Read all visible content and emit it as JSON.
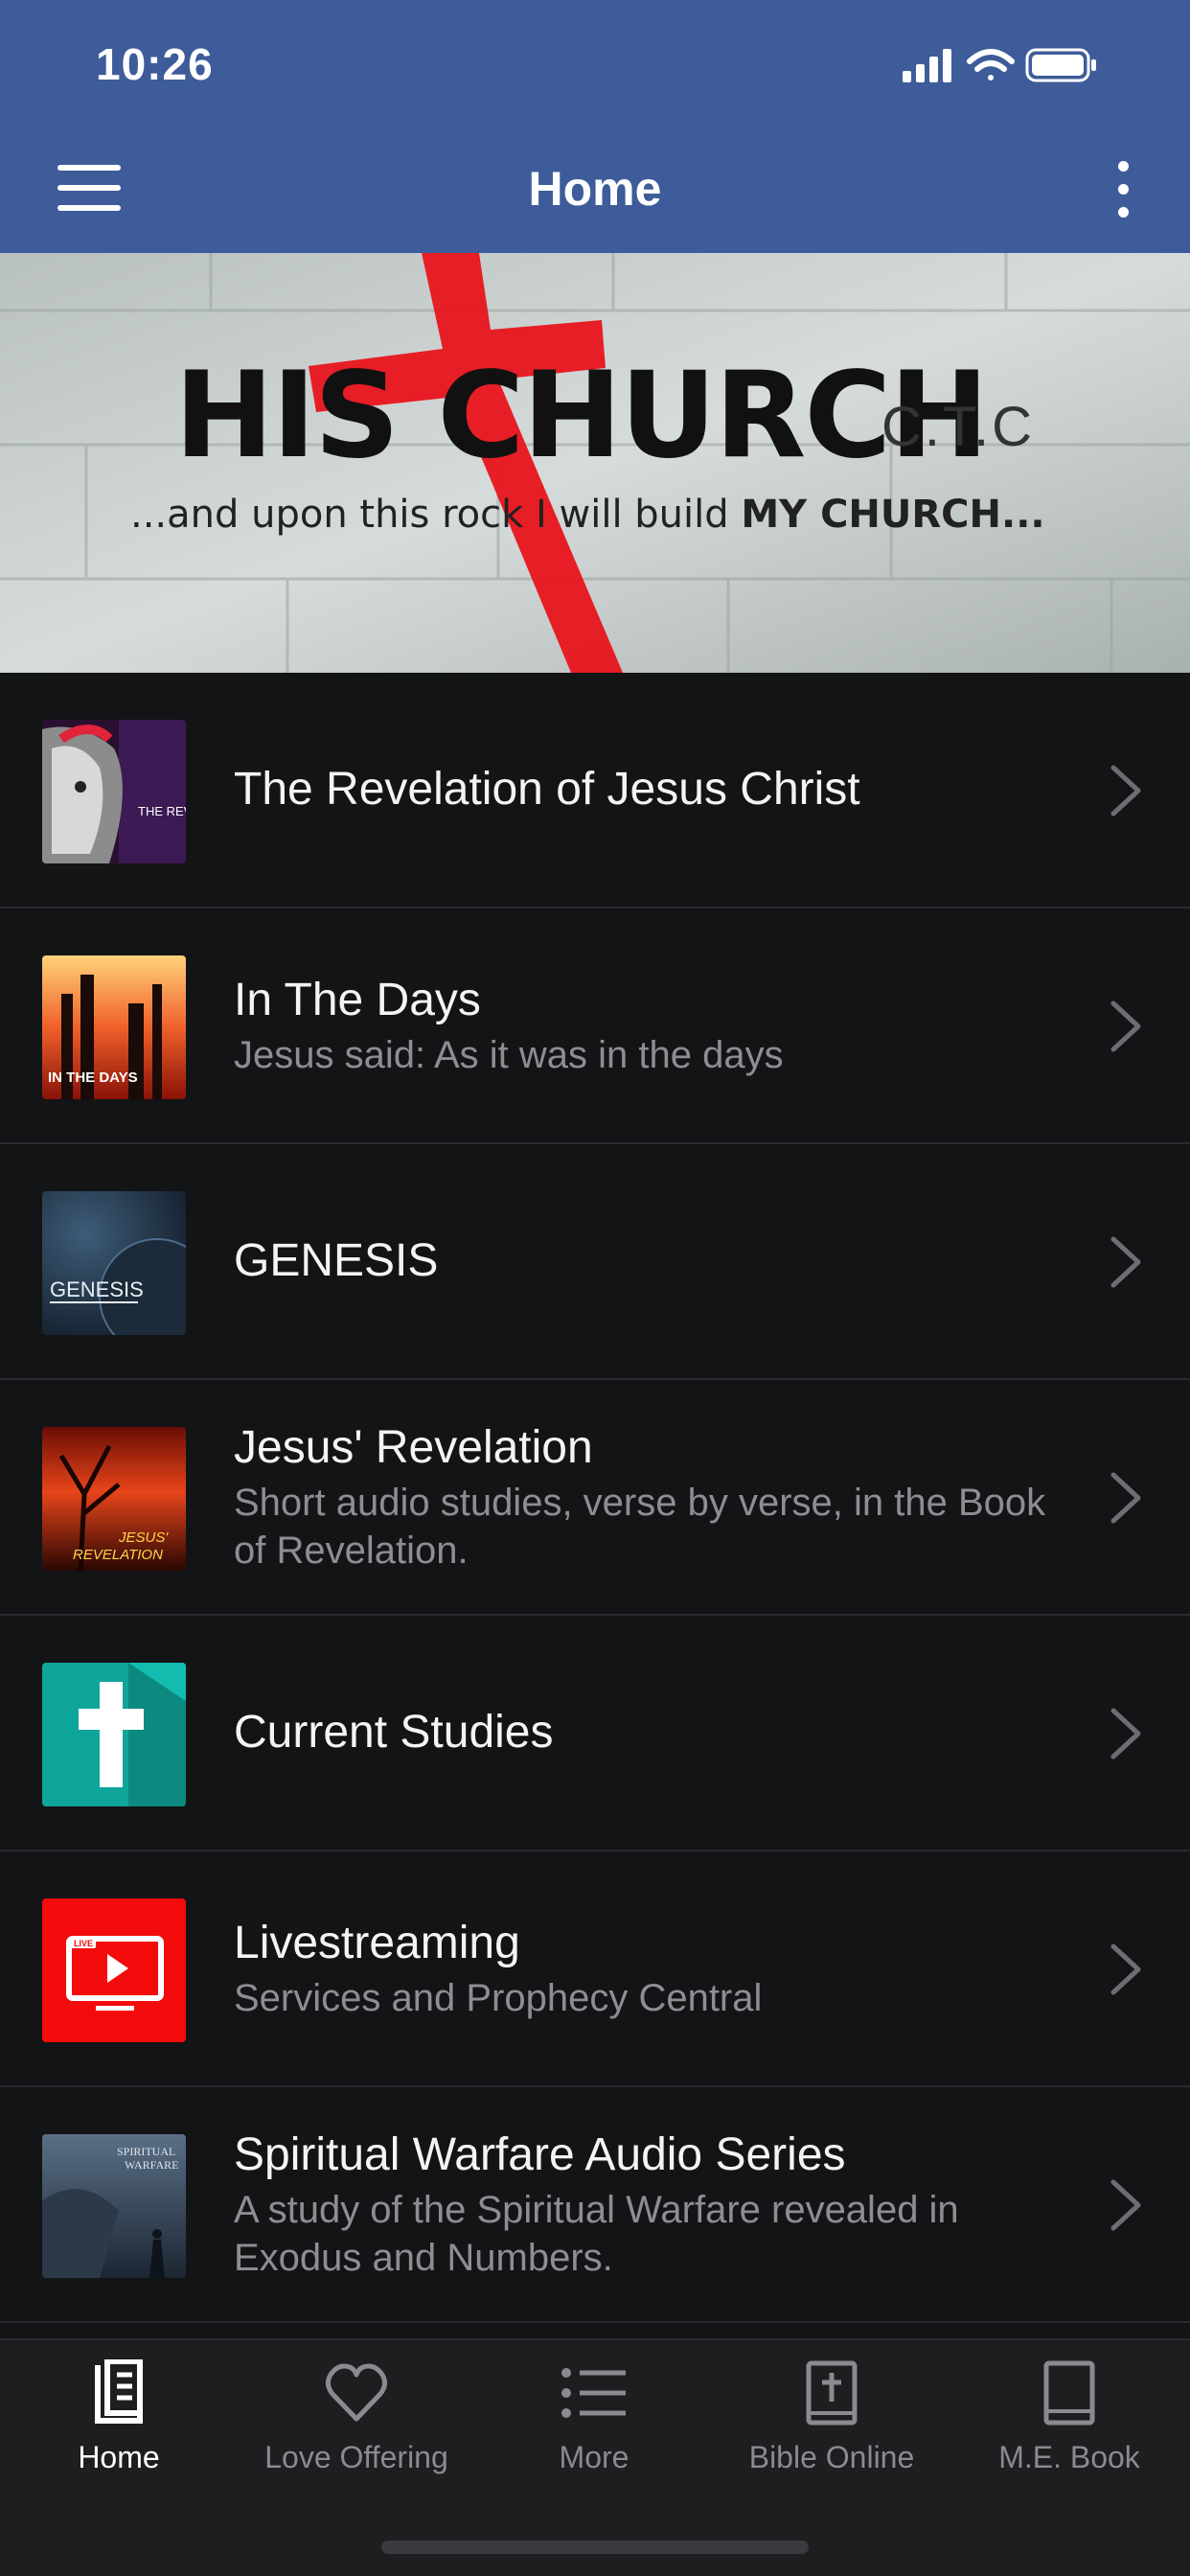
{
  "status_bar": {
    "time": "10:26"
  },
  "nav": {
    "title": "Home",
    "menu_icon": "hamburger-menu-icon",
    "more_icon": "vertical-ellipsis-icon"
  },
  "banner": {
    "title": "HIS CHURCH",
    "suffix": "C.T.C",
    "tagline_prefix": "...and upon this rock I will build ",
    "tagline_emphasis": "MY CHURCH...",
    "accent_color": "#e8141c"
  },
  "list": {
    "items": [
      {
        "title": "The Revelation of Jesus Christ",
        "subtitle": "",
        "thumb_text": "THE REVE JESUS"
      },
      {
        "title": "In The Days",
        "subtitle": "Jesus said: As it was in the days",
        "thumb_text": "IN THE DAYS"
      },
      {
        "title": "GENESIS",
        "subtitle": "",
        "thumb_text": "GENESIS"
      },
      {
        "title": "Jesus' Revelation",
        "subtitle": "Short audio studies, verse by verse, in the Book of Revelation.",
        "thumb_text_1": "JESUS'",
        "thumb_text_2": "REVELATION"
      },
      {
        "title": "Current Studies",
        "subtitle": "",
        "thumb_icon": "cross-icon"
      },
      {
        "title": "Livestreaming",
        "subtitle": "Services and Prophecy Central",
        "thumb_icon": "live-tv-icon",
        "thumb_text": "LIVE"
      },
      {
        "title": "Spiritual Warfare Audio Series",
        "subtitle": "A study of the Spiritual Warfare revealed in Exodus and Numbers.",
        "thumb_text_1": "SPIRITUAL",
        "thumb_text_2": "WARFARE"
      }
    ]
  },
  "tabs": [
    {
      "label": "Home",
      "icon": "book-icon",
      "active": true
    },
    {
      "label": "Love Offering",
      "icon": "heart-icon",
      "active": false
    },
    {
      "label": "More",
      "icon": "list-icon",
      "active": false
    },
    {
      "label": "Bible Online",
      "icon": "bible-icon",
      "active": false
    },
    {
      "label": "M.E. Book",
      "icon": "book-outline-icon",
      "active": false
    }
  ],
  "colors": {
    "header": "#3d5c99",
    "background": "#131416",
    "tabbar": "#1d1e20",
    "live_red": "#f40b0b",
    "studies_teal": "#0fa59a"
  }
}
